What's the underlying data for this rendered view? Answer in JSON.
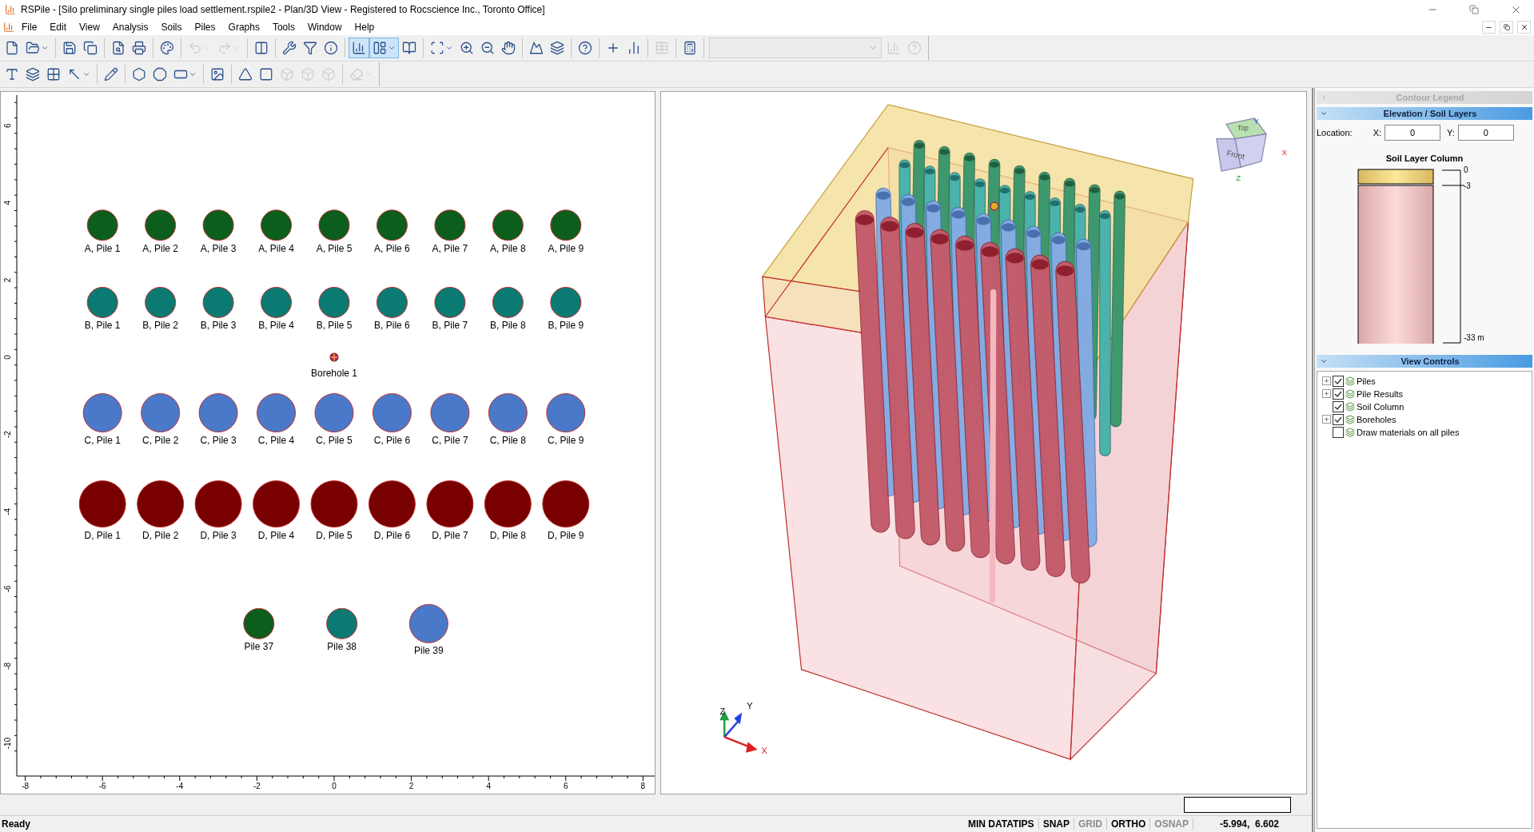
{
  "window": {
    "title": "RSPile - [Silo preliminary single piles load settlement.rspile2 - Plan/3D View - Registered to Rocscience Inc., Toronto Office]"
  },
  "menu": [
    "File",
    "Edit",
    "View",
    "Analysis",
    "Soils",
    "Piles",
    "Graphs",
    "Tools",
    "Window",
    "Help"
  ],
  "toolbar_1": [
    {
      "kind": "button",
      "selected": false,
      "disabled": false,
      "dropdown": false
    },
    {
      "kind": "button",
      "selected": false,
      "disabled": false,
      "dropdown": true
    },
    {
      "kind": "separator"
    },
    {
      "kind": "button",
      "selected": false,
      "disabled": false,
      "dropdown": false
    },
    {
      "kind": "button",
      "selected": false,
      "disabled": false,
      "dropdown": false
    },
    {
      "kind": "separator"
    },
    {
      "kind": "button",
      "selected": false,
      "disabled": false,
      "dropdown": false
    },
    {
      "kind": "button",
      "selected": false,
      "disabled": false,
      "dropdown": false
    },
    {
      "kind": "separator"
    },
    {
      "kind": "button",
      "selected": false,
      "disabled": false,
      "dropdown": false
    },
    {
      "kind": "separator"
    },
    {
      "kind": "button",
      "selected": false,
      "disabled": true,
      "dropdown": true
    },
    {
      "kind": "button",
      "selected": false,
      "disabled": true,
      "dropdown": true
    },
    {
      "kind": "separator"
    },
    {
      "kind": "button",
      "selected": false,
      "disabled": false,
      "dropdown": false
    },
    {
      "kind": "separator"
    },
    {
      "kind": "button",
      "selected": false,
      "disabled": false,
      "dropdown": false
    },
    {
      "kind": "button",
      "selected": false,
      "disabled": false,
      "dropdown": false
    },
    {
      "kind": "button",
      "selected": false,
      "disabled": false,
      "dropdown": false
    },
    {
      "kind": "separator"
    },
    {
      "kind": "button",
      "selected": true,
      "disabled": false,
      "dropdown": false
    },
    {
      "kind": "button",
      "selected": true,
      "disabled": false,
      "dropdown": true
    },
    {
      "kind": "button",
      "selected": false,
      "disabled": false,
      "dropdown": false
    },
    {
      "kind": "separator"
    },
    {
      "kind": "button",
      "selected": false,
      "disabled": false,
      "dropdown": true
    },
    {
      "kind": "button",
      "selected": false,
      "disabled": false,
      "dropdown": false
    },
    {
      "kind": "button",
      "selected": false,
      "disabled": false,
      "dropdown": false
    },
    {
      "kind": "button",
      "selected": false,
      "disabled": false,
      "dropdown": false
    },
    {
      "kind": "separator"
    },
    {
      "kind": "button",
      "selected": false,
      "disabled": false,
      "dropdown": false
    },
    {
      "kind": "button",
      "selected": false,
      "disabled": false,
      "dropdown": false
    },
    {
      "kind": "separator"
    },
    {
      "kind": "button",
      "selected": false,
      "disabled": false,
      "dropdown": false
    },
    {
      "kind": "separator"
    },
    {
      "kind": "button",
      "selected": false,
      "disabled": false,
      "dropdown": false
    },
    {
      "kind": "button",
      "selected": false,
      "disabled": false,
      "dropdown": false
    },
    {
      "kind": "separator"
    },
    {
      "kind": "button",
      "selected": false,
      "disabled": true,
      "dropdown": false
    },
    {
      "kind": "separator"
    },
    {
      "kind": "button",
      "selected": false,
      "disabled": false,
      "dropdown": false
    },
    {
      "kind": "separator"
    },
    {
      "kind": "combo",
      "disabled": true
    },
    {
      "kind": "button",
      "selected": false,
      "disabled": true,
      "dropdown": false
    },
    {
      "kind": "button",
      "selected": false,
      "disabled": true,
      "dropdown": false
    }
  ],
  "toolbar_2": [
    {
      "kind": "button",
      "selected": false,
      "disabled": false,
      "dropdown": false
    },
    {
      "kind": "button",
      "selected": false,
      "disabled": false,
      "dropdown": false
    },
    {
      "kind": "button",
      "selected": false,
      "disabled": false,
      "dropdown": false
    },
    {
      "kind": "button",
      "selected": false,
      "disabled": false,
      "dropdown": true
    },
    {
      "kind": "separator"
    },
    {
      "kind": "button",
      "selected": false,
      "disabled": false,
      "dropdown": false
    },
    {
      "kind": "separator"
    },
    {
      "kind": "button",
      "selected": false,
      "disabled": false,
      "dropdown": false
    },
    {
      "kind": "button",
      "selected": false,
      "disabled": false,
      "dropdown": false
    },
    {
      "kind": "button",
      "selected": false,
      "disabled": false,
      "dropdown": true
    },
    {
      "kind": "separator"
    },
    {
      "kind": "button",
      "selected": false,
      "disabled": false,
      "dropdown": false
    },
    {
      "kind": "separator"
    },
    {
      "kind": "button",
      "selected": false,
      "disabled": false,
      "dropdown": false
    },
    {
      "kind": "button",
      "selected": false,
      "disabled": false,
      "dropdown": false
    },
    {
      "kind": "button",
      "selected": false,
      "disabled": true,
      "dropdown": false
    },
    {
      "kind": "button",
      "selected": false,
      "disabled": true,
      "dropdown": false
    },
    {
      "kind": "button",
      "selected": false,
      "disabled": true,
      "dropdown": false
    },
    {
      "kind": "separator"
    },
    {
      "kind": "button",
      "selected": false,
      "disabled": true,
      "dropdown": true
    }
  ],
  "plan_view": {
    "x_ticks": [
      "-8",
      "-6",
      "-4",
      "-2",
      "0",
      "2",
      "4",
      "6",
      "8"
    ],
    "y_ticks": [
      "6",
      "4",
      "2",
      "0",
      "-2",
      "-4",
      "-6",
      "-8",
      "-10"
    ],
    "pile_rows": [
      {
        "color": "#0b5e1c",
        "piles": [
          "A, Pile 1",
          "A, Pile 2",
          "A, Pile 3",
          "A, Pile 4",
          "A, Pile 5",
          "A, Pile 6",
          "A, Pile 7",
          "A, Pile 8",
          "A, Pile 9"
        ]
      },
      {
        "color": "#0b7a72",
        "piles": [
          "B, Pile 1",
          "B, Pile 2",
          "B, Pile 3",
          "B, Pile 4",
          "B, Pile 5",
          "B, Pile 6",
          "B, Pile 7",
          "B, Pile 8",
          "B, Pile 9"
        ]
      },
      {
        "color": "#4a79c9",
        "piles": [
          "C, Pile 1",
          "C, Pile 2",
          "C, Pile 3",
          "C, Pile 4",
          "C, Pile 5",
          "C, Pile 6",
          "C, Pile 7",
          "C, Pile 8",
          "C, Pile 9"
        ]
      },
      {
        "color": "#780000",
        "piles": [
          "D, Pile 1",
          "D, Pile 2",
          "D, Pile 3",
          "D, Pile 4",
          "D, Pile 5",
          "D, Pile 6",
          "D, Pile 7",
          "D, Pile 8",
          "D, Pile 9"
        ]
      }
    ],
    "extra_piles": [
      {
        "label": "Pile 37",
        "color": "#0b5e1c"
      },
      {
        "label": "Pile 38",
        "color": "#0b7a72"
      },
      {
        "label": "Pile 39",
        "color": "#4a79c9"
      }
    ],
    "borehole": "Borehole 1"
  },
  "view_3d": {
    "axes": {
      "x": "X",
      "y": "Y",
      "z": "Z"
    },
    "view_cube": {
      "top": "Top",
      "front": "Front",
      "x": "X",
      "y": "Y",
      "z": "Z"
    }
  },
  "side_panel": {
    "contour_legend": {
      "title": "Contour Legend",
      "disabled": true
    },
    "elevation": {
      "title": "Elevation / Soil Layers",
      "location_label": "Location:",
      "x_label": "X:",
      "x_value": "0",
      "y_label": "Y:",
      "y_value": "0",
      "column_title": "Soil Layer Column",
      "elevations": [
        "0",
        "-3",
        "-33 m"
      ]
    },
    "view_controls": {
      "title": "View Controls",
      "items": [
        {
          "label": "Piles",
          "checked": true,
          "expanded": false
        },
        {
          "label": "Pile Results",
          "checked": true,
          "expanded": false
        },
        {
          "label": "Soil Column",
          "checked": true
        },
        {
          "label": "Boreholes",
          "checked": true,
          "expanded": false
        },
        {
          "label": "Draw materials on all piles",
          "checked": false
        }
      ]
    }
  },
  "status_bar": {
    "message": "Ready",
    "toggles": [
      {
        "label": "MIN DATATIPS",
        "on": true
      },
      {
        "label": "SNAP",
        "on": true
      },
      {
        "label": "GRID",
        "on": false
      },
      {
        "label": "ORTHO",
        "on": true
      },
      {
        "label": "OSNAP",
        "on": false
      }
    ],
    "coordinates": "-5.994,  6.602"
  }
}
